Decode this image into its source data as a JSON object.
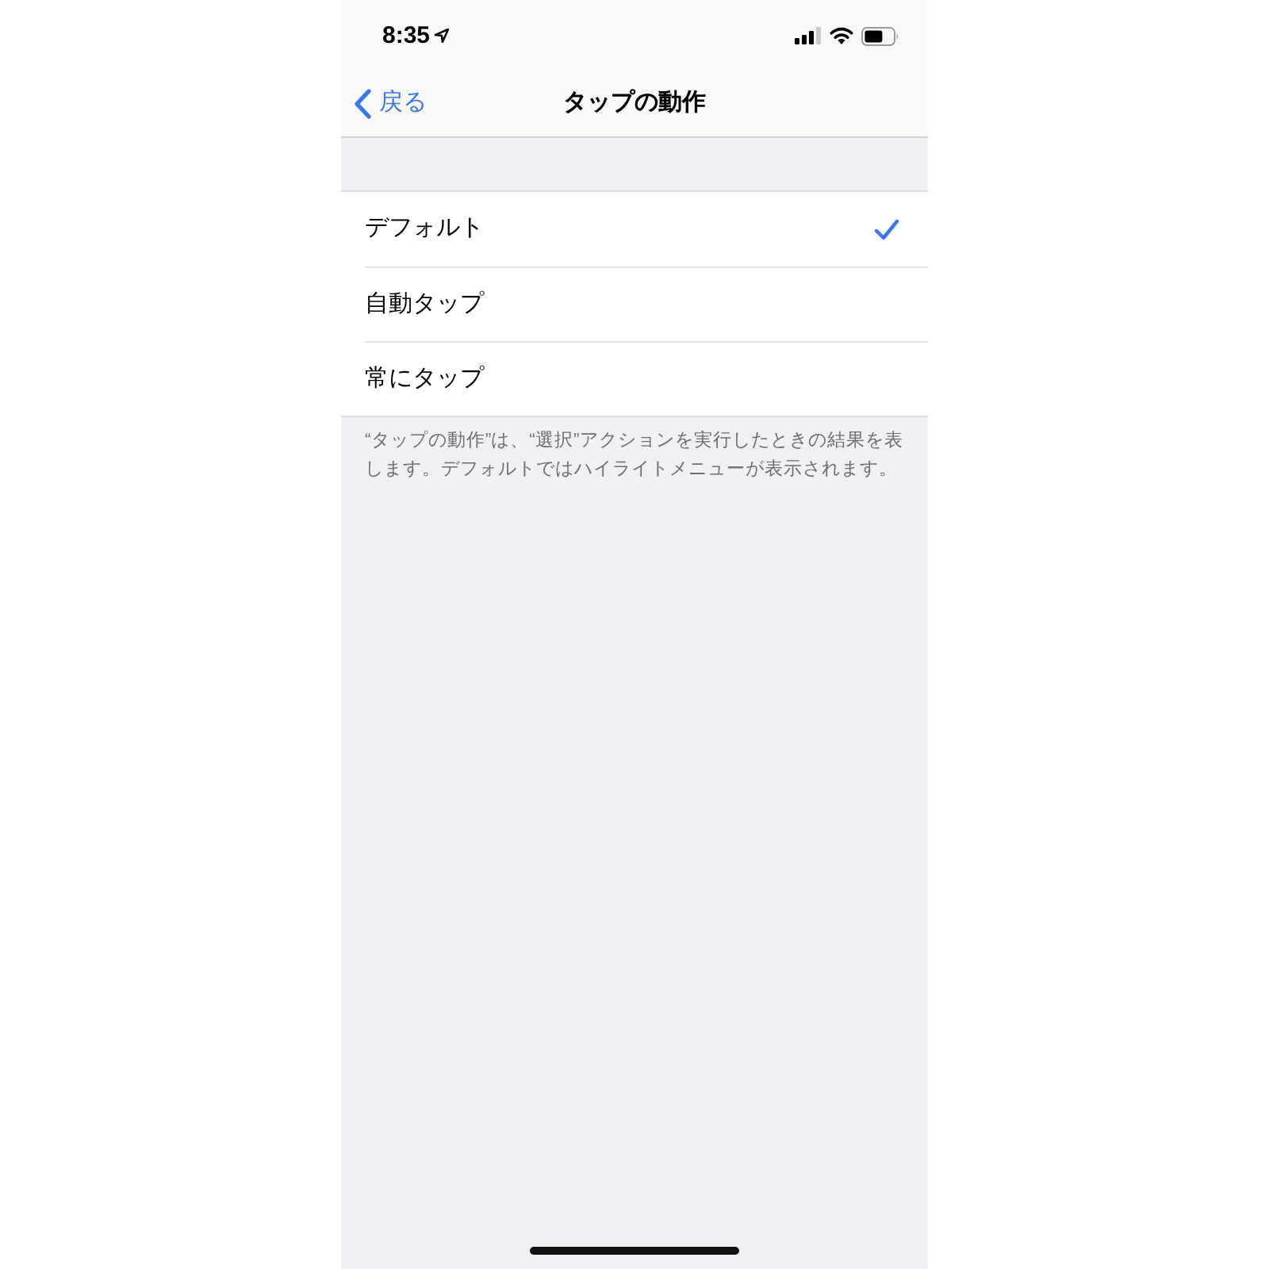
{
  "status_bar": {
    "time": "8:35"
  },
  "nav_bar": {
    "back": "戻る",
    "title": "タップの動作"
  },
  "options": [
    {
      "label": "デフォルト",
      "selected": true
    },
    {
      "label": "自動タップ",
      "selected": false
    },
    {
      "label": "常にタップ",
      "selected": false
    }
  ],
  "footer": "“タップの動作”は、“選択”アクションを実行したときの結果を表します。デフォルトではハイライトメニューが表示されます。"
}
